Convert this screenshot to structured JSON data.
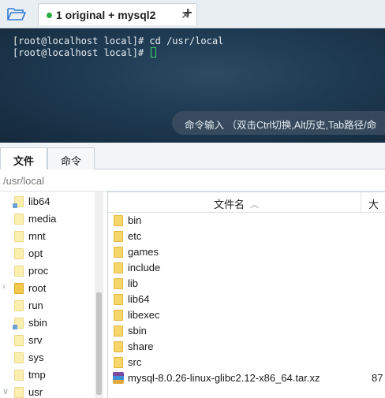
{
  "tabbar": {
    "folder_icon": "folder-open-icon",
    "active_tab_title": "1 original + mysql2",
    "close_glyph": "✕",
    "new_tab_glyph": "+",
    "status_color": "#27ae3e"
  },
  "terminal": {
    "lines": [
      "[root@localhost local]# cd /usr/local",
      "[root@localhost local]# "
    ],
    "command_hint": "命令输入 （双击Ctrl切换,Alt历史,Tab路径/命"
  },
  "panel": {
    "tabs": [
      "文件",
      "命令"
    ],
    "path": "/usr/local"
  },
  "tree": {
    "items": [
      {
        "label": "lib64",
        "icon": "folder-link-icon"
      },
      {
        "label": "media",
        "icon": "folder-icon"
      },
      {
        "label": "mnt",
        "icon": "folder-icon"
      },
      {
        "label": "opt",
        "icon": "folder-icon"
      },
      {
        "label": "proc",
        "icon": "folder-icon"
      },
      {
        "label": "root",
        "icon": "folder-icon",
        "expander": "›"
      },
      {
        "label": "run",
        "icon": "folder-icon"
      },
      {
        "label": "sbin",
        "icon": "folder-link-icon"
      },
      {
        "label": "srv",
        "icon": "folder-icon"
      },
      {
        "label": "sys",
        "icon": "folder-icon"
      },
      {
        "label": "tmp",
        "icon": "folder-icon"
      },
      {
        "label": "usr",
        "icon": "folder-icon",
        "expander": "∨"
      }
    ]
  },
  "filelist": {
    "column_name": "文件名",
    "column_size": "大",
    "sort_icon": "chevron-up-icon",
    "rows": [
      {
        "name": "bin",
        "type": "folder"
      },
      {
        "name": "etc",
        "type": "folder"
      },
      {
        "name": "games",
        "type": "folder"
      },
      {
        "name": "include",
        "type": "folder"
      },
      {
        "name": "lib",
        "type": "folder"
      },
      {
        "name": "lib64",
        "type": "folder"
      },
      {
        "name": "libexec",
        "type": "folder"
      },
      {
        "name": "sbin",
        "type": "folder"
      },
      {
        "name": "share",
        "type": "folder"
      },
      {
        "name": "src",
        "type": "folder"
      },
      {
        "name": "mysql-8.0.26-linux-glibc2.12-x86_64.tar.xz",
        "type": "archive",
        "size": "87"
      }
    ]
  }
}
